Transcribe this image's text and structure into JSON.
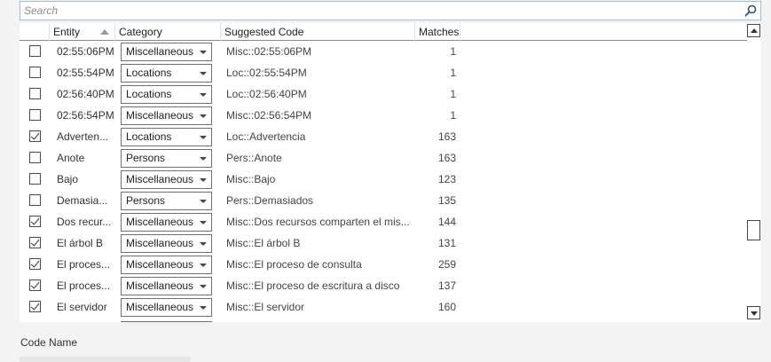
{
  "search": {
    "placeholder": "Search",
    "value": ""
  },
  "columns": {
    "entity": "Entity",
    "category": "Category",
    "suggested_code": "Suggested Code",
    "matches": "Matches"
  },
  "rows": [
    {
      "checked": false,
      "entity": "02:55:06PM",
      "category": "Miscellaneous",
      "code": "Misc::02:55:06PM",
      "matches": "1"
    },
    {
      "checked": false,
      "entity": "02:55:54PM",
      "category": "Locations",
      "code": "Loc::02:55:54PM",
      "matches": "1"
    },
    {
      "checked": false,
      "entity": "02:56:40PM",
      "category": "Locations",
      "code": "Loc::02:56:40PM",
      "matches": "1"
    },
    {
      "checked": false,
      "entity": "02:56:54PM",
      "category": "Miscellaneous",
      "code": "Misc::02:56:54PM",
      "matches": "1"
    },
    {
      "checked": true,
      "entity": "Adverten...",
      "category": "Locations",
      "code": "Loc::Advertencia",
      "matches": "163"
    },
    {
      "checked": false,
      "entity": "Anote",
      "category": "Persons",
      "code": "Pers::Anote",
      "matches": "163"
    },
    {
      "checked": false,
      "entity": "Bajo",
      "category": "Miscellaneous",
      "code": "Misc::Bajo",
      "matches": "123"
    },
    {
      "checked": false,
      "entity": "Demasia...",
      "category": "Persons",
      "code": "Pers::Demasiados",
      "matches": "135"
    },
    {
      "checked": true,
      "entity": "Dos recur...",
      "category": "Miscellaneous",
      "code": "Misc::Dos recursos comparten el mis...",
      "matches": "144"
    },
    {
      "checked": true,
      "entity": "El árbol B",
      "category": "Miscellaneous",
      "code": "Misc::El árbol B",
      "matches": "131"
    },
    {
      "checked": true,
      "entity": "El proces...",
      "category": "Miscellaneous",
      "code": "Misc::El proceso de consulta",
      "matches": "259"
    },
    {
      "checked": true,
      "entity": "El proces...",
      "category": "Miscellaneous",
      "code": "Misc::El proceso de escritura a disco",
      "matches": "137"
    },
    {
      "checked": true,
      "entity": "El servidor",
      "category": "Miscellaneous",
      "code": "Misc::El servidor",
      "matches": "160"
    }
  ],
  "code_name": {
    "label": "Code Name",
    "value": ""
  },
  "icons": {
    "search": "search-icon",
    "sort": "sort-ascending-icon",
    "dropdown": "chevron-down-icon",
    "scroll_up": "scroll-up-icon",
    "scroll_down": "scroll-down-icon"
  },
  "colors": {
    "search_border": "#9fbfd6",
    "background": "#f3f3f3"
  }
}
